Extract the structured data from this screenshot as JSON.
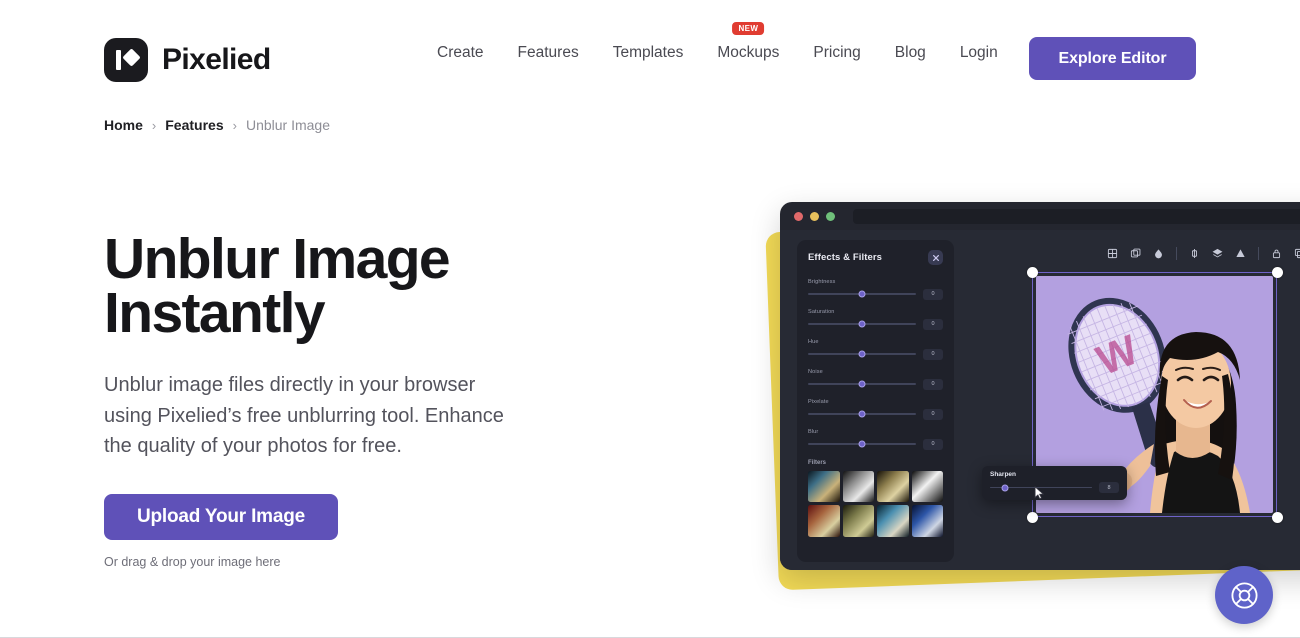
{
  "header": {
    "brand_name": "Pixelied",
    "logo_icon": "pixelied-logo-icon",
    "nav_items": [
      {
        "label": "Create",
        "badge": null
      },
      {
        "label": "Features",
        "badge": null
      },
      {
        "label": "Templates",
        "badge": null
      },
      {
        "label": "Mockups",
        "badge": "NEW"
      },
      {
        "label": "Pricing",
        "badge": null
      },
      {
        "label": "Blog",
        "badge": null
      },
      {
        "label": "Login",
        "badge": null
      }
    ],
    "cta_label": "Explore Editor",
    "cta_color": "#5f51b8",
    "badge_color": "#e03c31"
  },
  "breadcrumb": {
    "separator": "›",
    "items": [
      {
        "label": "Home",
        "current": false
      },
      {
        "label": "Features",
        "current": false
      },
      {
        "label": "Unblur Image",
        "current": true
      }
    ]
  },
  "hero": {
    "title": "Unblur Image\nInstantly",
    "subtitle": "Unblur image files directly in your browser\nusing Pixelied’s free unblurring tool. Enhance\nthe quality of your photos for free.",
    "upload_label": "Upload Your Image",
    "drop_hint": "Or drag & drop your image here",
    "button_color": "#5f51b8"
  },
  "mockup": {
    "window_dots": [
      "#e0696a",
      "#e7c05c",
      "#6fc07a"
    ],
    "accent_plate_color": "#f2da57",
    "panel": {
      "title": "Effects & Filters",
      "close_icon": "close-icon",
      "sliders": [
        {
          "label": "Brightness",
          "value": "0"
        },
        {
          "label": "Saturation",
          "value": "0"
        },
        {
          "label": "Hue",
          "value": "0"
        },
        {
          "label": "Noise",
          "value": "0"
        },
        {
          "label": "Pixelate",
          "value": "0"
        },
        {
          "label": "Blur",
          "value": "0"
        }
      ],
      "filters_title": "Filters",
      "filter_swatches": [
        "linear-gradient(135deg,#0b1720 0%,#3d6e86 30%,#c9b27a 65%,#1a1208 100%)",
        "linear-gradient(135deg,#121212 0%,#8d8d8d 35%,#e8e8e8 65%,#171717 100%)",
        "linear-gradient(135deg,#141008 0%,#8e7f4e 35%,#ded2a2 65%,#1c1608 100%)",
        "linear-gradient(135deg,#0a0a0a 0%,#f2f2f2 45%,#0d0d0d 100%)",
        "linear-gradient(135deg,#5d0f10 0%,#a6643e 35%,#d9cfa0 70%,#2a1109 100%)",
        "linear-gradient(135deg,#1a1a0c 0%,#7b7a4a 35%,#cfcb95 70%,#1f1e10 100%)",
        "linear-gradient(135deg,#06202e 0%,#4a8fb0 35%,#d9d6c3 70%,#0c1a22 100%)",
        "linear-gradient(135deg,#071232 0%,#2d56a8 35%,#cfd6e4 70%,#0a1028 100%)"
      ]
    },
    "toolbar_icons": [
      "crop-icon",
      "duplicate-layer-icon",
      "opacity-droplet-icon",
      "flip-vertical-icon",
      "layers-icon",
      "gradient-icon",
      "lock-icon",
      "copy-icon",
      "trash-icon"
    ],
    "sharpen": {
      "label": "Sharpen",
      "value": "8"
    },
    "photo_alt": "woman-with-tennis-racket-photo"
  },
  "help_widget": {
    "icon": "lifebuoy-icon",
    "color": "#5f63c9"
  }
}
